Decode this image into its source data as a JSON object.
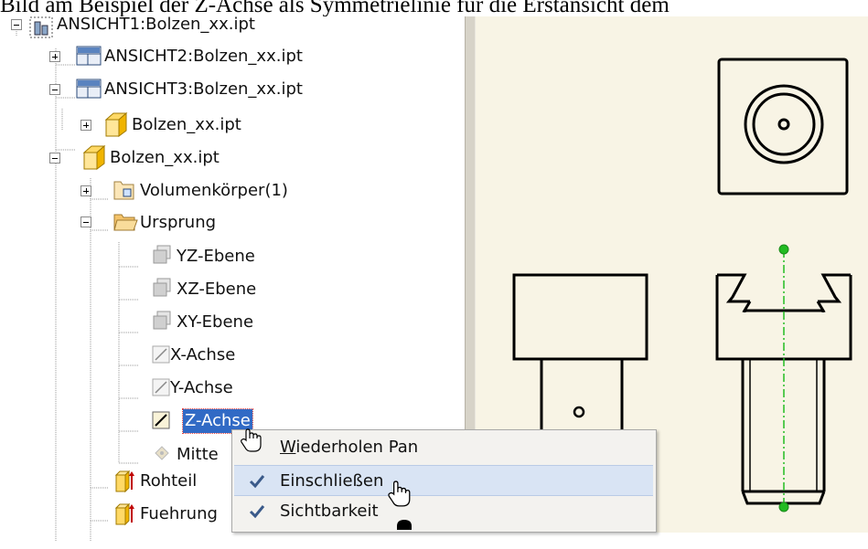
{
  "caption": "Bild am Beispiel der Z-Achse als Symmetrielinie für die Erstansicht dem",
  "tree": {
    "items": [
      {
        "label": "ANSICHT1:Bolzen_xx.ipt"
      },
      {
        "label": "ANSICHT2:Bolzen_xx.ipt"
      },
      {
        "label": "ANSICHT3:Bolzen_xx.ipt"
      },
      {
        "label": "Bolzen_xx.ipt"
      },
      {
        "label": "Bolzen_xx.ipt"
      },
      {
        "label": "Volumenkörper(1)"
      },
      {
        "label": "Ursprung"
      },
      {
        "label": "YZ-Ebene"
      },
      {
        "label": "XZ-Ebene"
      },
      {
        "label": "XY-Ebene"
      },
      {
        "label": "X-Achse"
      },
      {
        "label": "Y-Achse"
      },
      {
        "label": "Z-Achse"
      },
      {
        "label": "Mitte"
      },
      {
        "label": "Rohteil"
      },
      {
        "label": "Fuehrung"
      }
    ]
  },
  "context_menu": {
    "items": [
      {
        "label_ul": "W",
        "label_rest": "iederholen Pan",
        "checked": false
      },
      {
        "label_ul": "",
        "label_rest": "Einschließen",
        "checked": true
      },
      {
        "label_ul": "",
        "label_rest": "Sichtbarkeit",
        "checked": true
      }
    ]
  },
  "colors": {
    "selection": "#316ac5",
    "menu_hover": "#d9e4f4",
    "drawing_bg": "#f8f4e5",
    "centerline": "#22bb22"
  }
}
